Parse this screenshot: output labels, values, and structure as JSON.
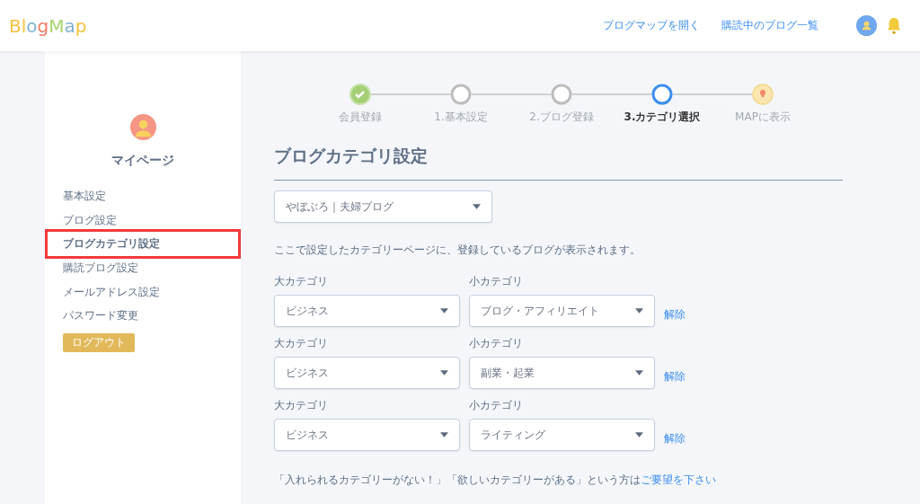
{
  "header": {
    "logo": [
      {
        "char": "B",
        "color": "#f5c342"
      },
      {
        "char": "l",
        "color": "#f5c342"
      },
      {
        "char": "o",
        "color": "#7fb3d0"
      },
      {
        "char": "g",
        "color": "#f07a62"
      },
      {
        "char": "M",
        "color": "#a6d46a"
      },
      {
        "char": "a",
        "color": "#7fb3d0"
      },
      {
        "char": "p",
        "color": "#f5c342"
      }
    ],
    "links": [
      "ブログマップを開く",
      "購読中のブログ一覧"
    ]
  },
  "sidebar": {
    "title": "マイページ",
    "items": [
      {
        "label": "基本設定",
        "selected": false
      },
      {
        "label": "ブログ設定",
        "selected": false
      },
      {
        "label": "ブログカテゴリ設定",
        "selected": true
      },
      {
        "label": "購読ブログ設定",
        "selected": false
      },
      {
        "label": "メールアドレス設定",
        "selected": false
      },
      {
        "label": "パスワード変更",
        "selected": false
      }
    ],
    "logout": "ログアウト"
  },
  "steps": [
    {
      "label": "会員登録",
      "kind": "done"
    },
    {
      "label": "1.基本設定",
      "kind": "todo"
    },
    {
      "label": "2.ブログ登録",
      "kind": "todo"
    },
    {
      "label": "3.カテゴリ選択",
      "kind": "current"
    },
    {
      "label": "MAPに表示",
      "kind": "goal"
    }
  ],
  "heading": "ブログカテゴリ設定",
  "blog_select": {
    "value": "やぼぶろ｜夫婦ブログ"
  },
  "description": "ここで設定したカテゴリーページに、登録しているブログが表示されます。",
  "category_rows": [
    {
      "major_label": "大カテゴリ",
      "major": "ビジネス",
      "minor_label": "小カテゴリ",
      "minor": "ブログ・アフィリエイト",
      "remove": "解除"
    },
    {
      "major_label": "大カテゴリ",
      "major": "ビジネス",
      "minor_label": "小カテゴリ",
      "minor": "副業・起業",
      "remove": "解除"
    },
    {
      "major_label": "大カテゴリ",
      "major": "ビジネス",
      "minor_label": "小カテゴリ",
      "minor": "ライティング",
      "remove": "解除"
    }
  ],
  "footer_note": {
    "text": "「入れられるカテゴリーがない！」「欲しいカテゴリーがある」という方は",
    "link": "ご要望を下さい"
  }
}
